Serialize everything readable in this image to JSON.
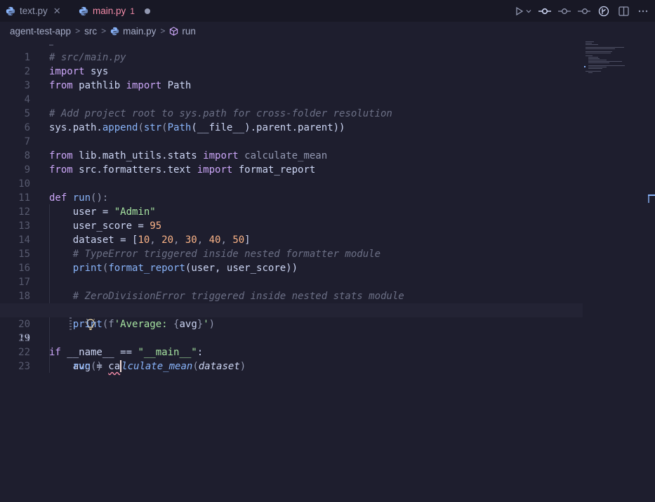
{
  "tabs": [
    {
      "name": "text.py",
      "close": "✕"
    },
    {
      "name": "main.py",
      "problems": "1"
    }
  ],
  "breadcrumb": [
    "agent-test-app",
    "src",
    "main.py",
    "run"
  ],
  "editor": {
    "ellipsis": "…",
    "current_line": 19,
    "line_numbers": [
      "1",
      "2",
      "3",
      "4",
      "5",
      "6",
      "7",
      "8",
      "9",
      "10",
      "11",
      "12",
      "13",
      "14",
      "15",
      "16",
      "17",
      "18",
      "19",
      "20",
      "21",
      "22",
      "23"
    ],
    "code": {
      "l1": "# src/main.py",
      "l2_kw": "import",
      "l2_mod": " sys",
      "l3_kw1": "from",
      "l3_mod": " pathlib ",
      "l3_kw2": "import",
      "l3_cls": " Path",
      "l5": "# Add project root to sys.path for cross-folder resolution",
      "l6_a": "sys.path.",
      "l6_fn": "append",
      "l6_b": "(",
      "l6_str": "str",
      "l6_c": "(",
      "l6_path": "Path",
      "l6_d": "(__file__).parent.parent))",
      "l8_kw1": "from",
      "l8_mod": " lib.math_utils.stats ",
      "l8_kw2": "import",
      "l8_name": " calculate_mean",
      "l9_kw1": "from",
      "l9_mod": " src.formatters.text ",
      "l9_kw2": "import",
      "l9_name": " format_report",
      "l11_kw": "def",
      "l11_fn": " run",
      "l11_rest": "():",
      "l12_a": "    user = ",
      "l12_str": "\"Admin\"",
      "l13_a": "    user_score = ",
      "l13_num": "95",
      "l14_a": "    dataset = [",
      "l14_n1": "10",
      "l14_c1": ", ",
      "l14_n2": "20",
      "l14_c2": ", ",
      "l14_n3": "30",
      "l14_c3": ", ",
      "l14_n4": "40",
      "l14_c4": ", ",
      "l14_n5": "50",
      "l14_b": "]",
      "l15": "    # TypeError triggered inside nested formatter module",
      "l16_a": "    ",
      "l16_fn1": "print",
      "l16_b": "(",
      "l16_fn2": "format_report",
      "l16_c": "(user, user_score))",
      "l18": "    # ZeroDivisionError triggered inside nested stats module",
      "l19_a": "    avg = ",
      "l19_err": "ca",
      "l19_fn": "lculate_mean",
      "l19_b": "(",
      "l19_p": "dataset",
      "l19_c": ")",
      "l20_a": "    ",
      "l20_fn": "print",
      "l20_b": "(f",
      "l20_str1": "'Average: ",
      "l20_br1": "{",
      "l20_v": "avg",
      "l20_br2": "}",
      "l20_str2": "'",
      "l20_c": ")",
      "l22_kw": "if",
      "l22_a": " __name__ == ",
      "l22_str": "\"__main__\"",
      "l22_b": ":",
      "l23_a": "    ",
      "l23_fn": "run",
      "l23_b": "()"
    }
  },
  "colors": {
    "background": "#1e1e2e",
    "tabbar": "#181825",
    "keyword": "#cba6f7",
    "string": "#a6e3a1",
    "number": "#fab387",
    "function": "#89b4fa",
    "comment": "#6c7086",
    "error": "#f38ba8"
  }
}
